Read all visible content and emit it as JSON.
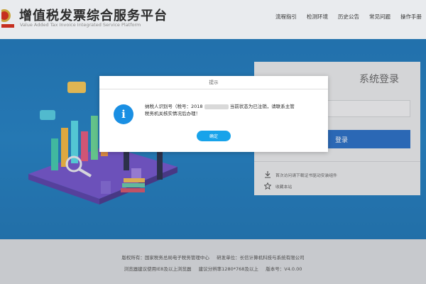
{
  "header": {
    "title": "增值税发票综合服务平台",
    "subtitle": "Value Added Tax Invoice Integrated Service Platform",
    "nav": [
      "流程指引",
      "检测环境",
      "历史公告",
      "常见问题",
      "操作手册"
    ]
  },
  "login": {
    "title": "系统登录",
    "button": "登录",
    "links": [
      {
        "icon": "download-icon",
        "text": "首次访问请下载证书驱动安装组件"
      },
      {
        "icon": "star-icon",
        "text": "收藏本站"
      }
    ]
  },
  "modal": {
    "title": "提示",
    "message_part1": "纳税人识别号（税号：2018",
    "message_part2": "当前状态为已注销，请联系主管",
    "message_line2": "税务机关核实情况后办理！",
    "ok": "确定"
  },
  "footer": {
    "line1_a": "版权所有：国家税务总局电子税务管理中心",
    "line1_b": "研发单位：长信计算机科技与系统有限公司",
    "line2_a": "浏览器建议使用IE8及以上浏览器",
    "line2_b": "建议分辨率1280*768及以上",
    "line2_c": "版本号：V4.0.00"
  },
  "colors": {
    "banner": "#1378bf",
    "primary": "#1a64c1",
    "info": "#1a8fe3",
    "ok": "#18a3ea"
  }
}
